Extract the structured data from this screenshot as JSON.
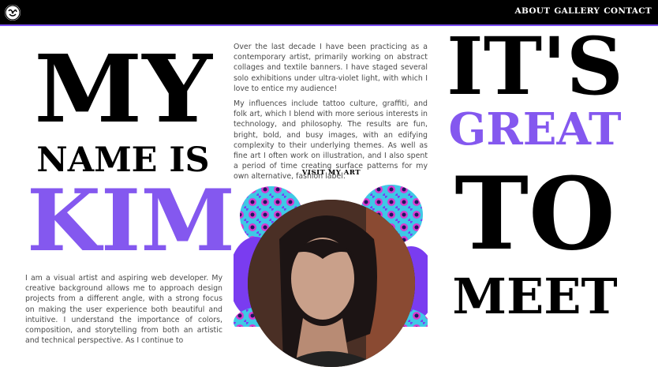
{
  "nav": {
    "logo": "logo-icon",
    "links": [
      "ABOUT",
      "GALLERY",
      "CONTACT"
    ]
  },
  "hero_left": {
    "line1": "MY",
    "line2": "NAME IS",
    "line3": "KIM"
  },
  "hero_right": {
    "line1": "IT'S",
    "line2": "GREAT",
    "line3": "TO",
    "line4": "MEET"
  },
  "intro": {
    "paragraph1": "Over the last decade I have been practicing as a contemporary artist, primarily working on abstract collages and textile banners. I have staged several solo exhibitions under ultra-violet light, with which I love to entice my audience!",
    "paragraph2": "My influences include tattoo culture, graffiti, and folk art, which I blend with more serious interests in technology, and philosophy. The results are fun, bright, bold, and busy images, with an edifying complexity to their underlying themes. As well as fine art I often work on illustration, and I also spent a period of time creating surface patterns for my own alternative, fashion label.",
    "visit_link": "VISIT MY ART"
  },
  "bio": {
    "paragraph": "I am a visual artist and aspiring web developer. My creative background allows me to approach design projects from a different angle, with a strong focus on making the user experience both beautiful and intuitive. I understand the importance of colors, composition, and storytelling from both an artistic and technical perspective. As I continue to"
  },
  "colors": {
    "accent": "#8458ef",
    "text": "#000000",
    "body": "#4a4a4a",
    "bar": "#000000"
  }
}
